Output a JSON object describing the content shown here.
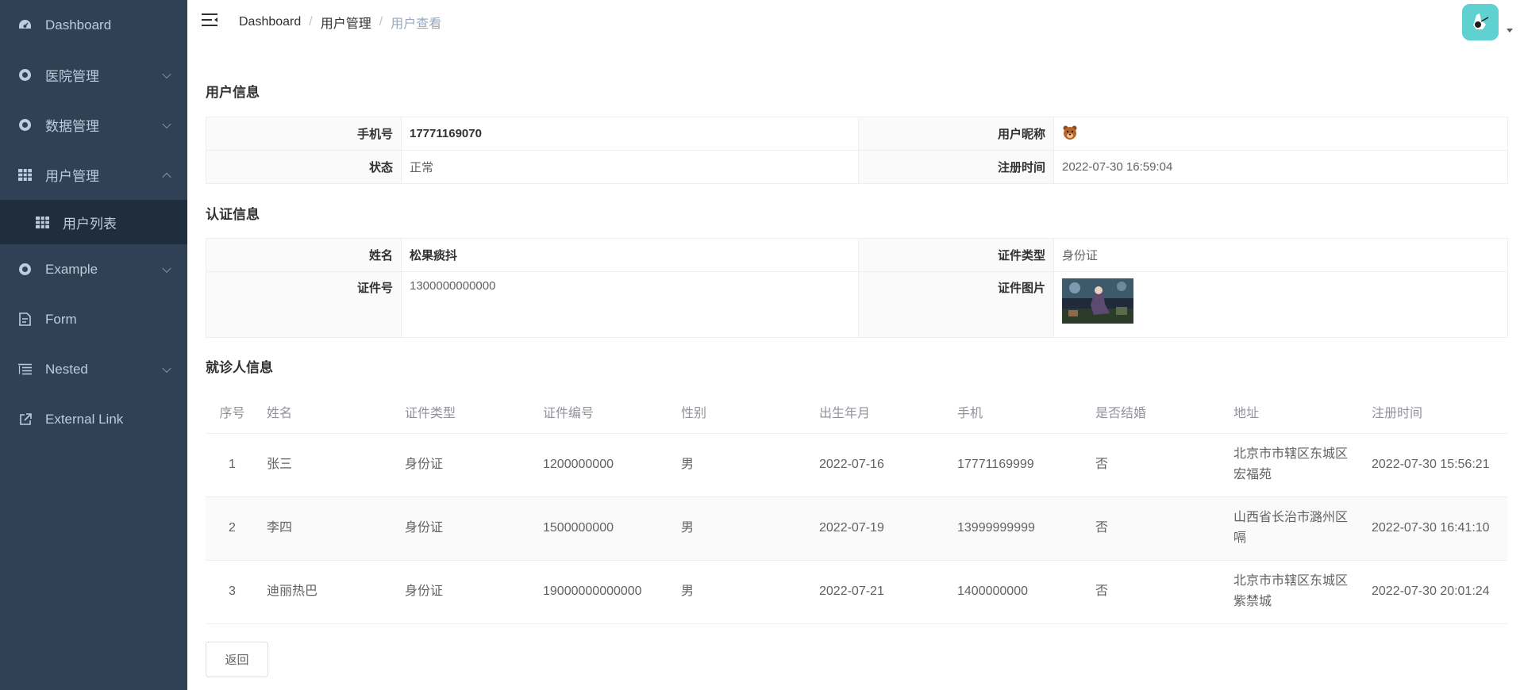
{
  "sidebar": {
    "items": [
      {
        "label": "Dashboard",
        "icon": "dashboard-icon"
      },
      {
        "label": "医院管理",
        "icon": "help-circle-icon",
        "expandable": true
      },
      {
        "label": "数据管理",
        "icon": "help-circle-icon",
        "expandable": true
      },
      {
        "label": "用户管理",
        "icon": "table-icon",
        "expandable": true,
        "expanded": true,
        "children": [
          {
            "label": "用户列表",
            "icon": "table-icon"
          }
        ]
      },
      {
        "label": "Example",
        "icon": "help-circle-icon",
        "expandable": true
      },
      {
        "label": "Form",
        "icon": "form-icon"
      },
      {
        "label": "Nested",
        "icon": "nested-icon",
        "expandable": true
      },
      {
        "label": "External Link",
        "icon": "external-link-icon"
      }
    ]
  },
  "navbar": {
    "breadcrumb": [
      "Dashboard",
      "用户管理",
      "用户查看"
    ]
  },
  "user_info": {
    "title": "用户信息",
    "phone_label": "手机号",
    "phone": "17771169070",
    "nickname_label": "用户昵称",
    "status_label": "状态",
    "status": "正常",
    "register_label": "注册时间",
    "register_time": "2022-07-30 16:59:04"
  },
  "auth_info": {
    "title": "认证信息",
    "name_label": "姓名",
    "name": "松果痰抖",
    "cert_type_label": "证件类型",
    "cert_type": "身份证",
    "cert_no_label": "证件号",
    "cert_no": "1300000000000",
    "cert_img_label": "证件图片"
  },
  "patients": {
    "title": "就诊人信息",
    "columns": [
      "序号",
      "姓名",
      "证件类型",
      "证件编号",
      "性别",
      "出生年月",
      "手机",
      "是否结婚",
      "地址",
      "注册时间"
    ],
    "rows": [
      [
        "1",
        "张三",
        "身份证",
        "1200000000",
        "男",
        "2022-07-16",
        "17771169999",
        "否",
        "北京市市辖区东城区宏福苑",
        "2022-07-30 15:56:21"
      ],
      [
        "2",
        "李四",
        "身份证",
        "1500000000",
        "男",
        "2022-07-19",
        "13999999999",
        "否",
        "山西省长治市潞州区嗝",
        "2022-07-30 16:41:10"
      ],
      [
        "3",
        "迪丽热巴",
        "身份证",
        "19000000000000",
        "男",
        "2022-07-21",
        "1400000000",
        "否",
        "北京市市辖区东城区紫禁城",
        "2022-07-30 20:01:24"
      ]
    ]
  },
  "actions": {
    "back": "返回"
  },
  "colors": {
    "sidebar_bg": "#304156",
    "submenu_bg": "#1f2d3d",
    "sidebar_text": "#bfcbd9",
    "avatar_bg": "#5fd1d1"
  }
}
